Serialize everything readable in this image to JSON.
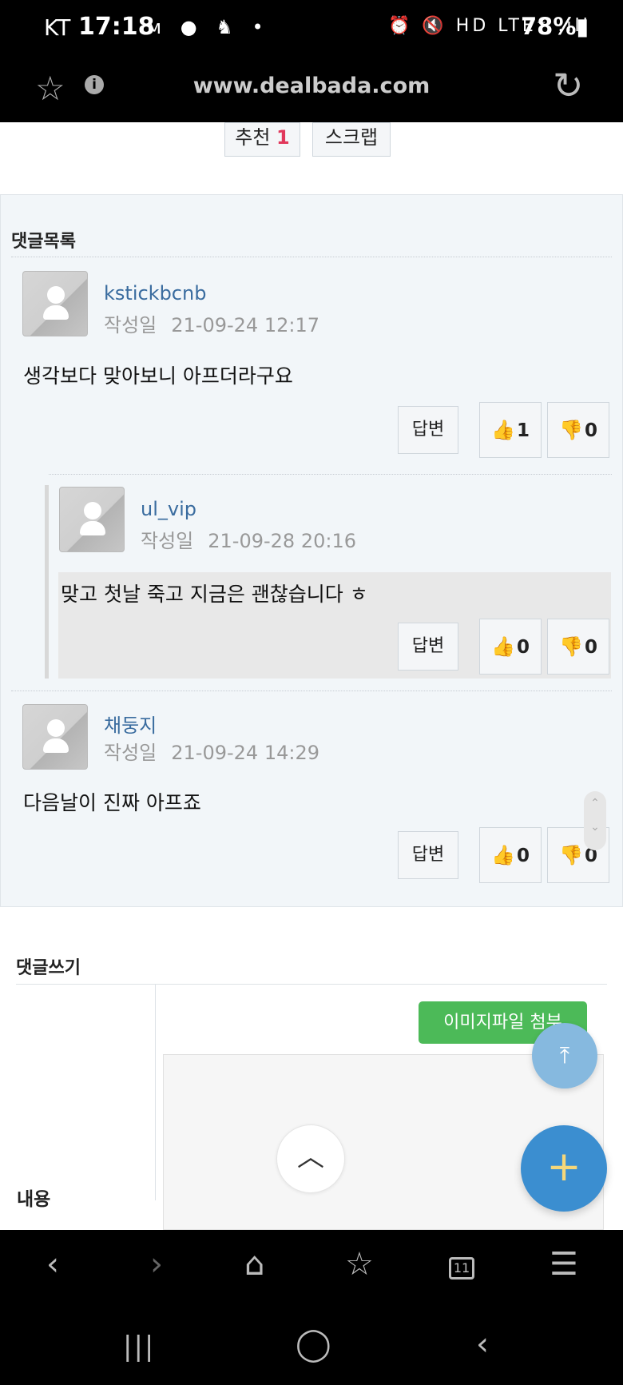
{
  "status_bar": {
    "carrier": "KT",
    "time": "17:18",
    "left_icons": "ᴍ ● ♞ •",
    "right_icons": "⏰ 🔇 HD LTE⁺ .ıll",
    "battery": "78%▮"
  },
  "url_bar": {
    "url": "www.dealbada.com",
    "star_glyph": "☆",
    "info_glyph": "i",
    "reload_glyph": "↻"
  },
  "post_actions": {
    "recommend_label": "추천",
    "recommend_count": "1",
    "scrap_label": "스크랩"
  },
  "comments": {
    "title": "댓글목록",
    "date_label": "작성일",
    "reply_label": "답변",
    "items": [
      {
        "author": "kstickbcnb",
        "date": "21-09-24 12:17",
        "text": "생각보다 맞아보니 아프더라구요",
        "likes": "1",
        "dislikes": "0"
      },
      {
        "author": "ul_vip",
        "date": "21-09-28 20:16",
        "text": "맞고 첫날 죽고 지금은 괜찮습니다 ㅎ",
        "likes": "0",
        "dislikes": "0"
      },
      {
        "author": "채둥지",
        "date": "21-09-24 14:29",
        "text": "다음날이 진짜 아프죠",
        "likes": "0",
        "dislikes": "0"
      }
    ]
  },
  "comment_write": {
    "title": "댓글쓰기",
    "content_label": "내용",
    "attach_label": "이미지파일 첨부"
  },
  "icons": {
    "thumb_up": "👍",
    "thumb_down": "👎",
    "scroll_top": "⤒",
    "plus": "+",
    "chevron_up": "︿"
  },
  "browser_toolbar": {
    "back": "‹",
    "forward": "›",
    "home": "⌂",
    "bookmarks": "☆",
    "tab_count": "11",
    "menu": "☰"
  },
  "nav_bar": {
    "recents": "|||",
    "home": "◯",
    "back": "‹"
  },
  "colors": {
    "accent_blue": "#3a6c9f",
    "recommend_red": "#e1385b",
    "attach_green": "#4cba58",
    "fab_blue": "#3b8ed0"
  }
}
